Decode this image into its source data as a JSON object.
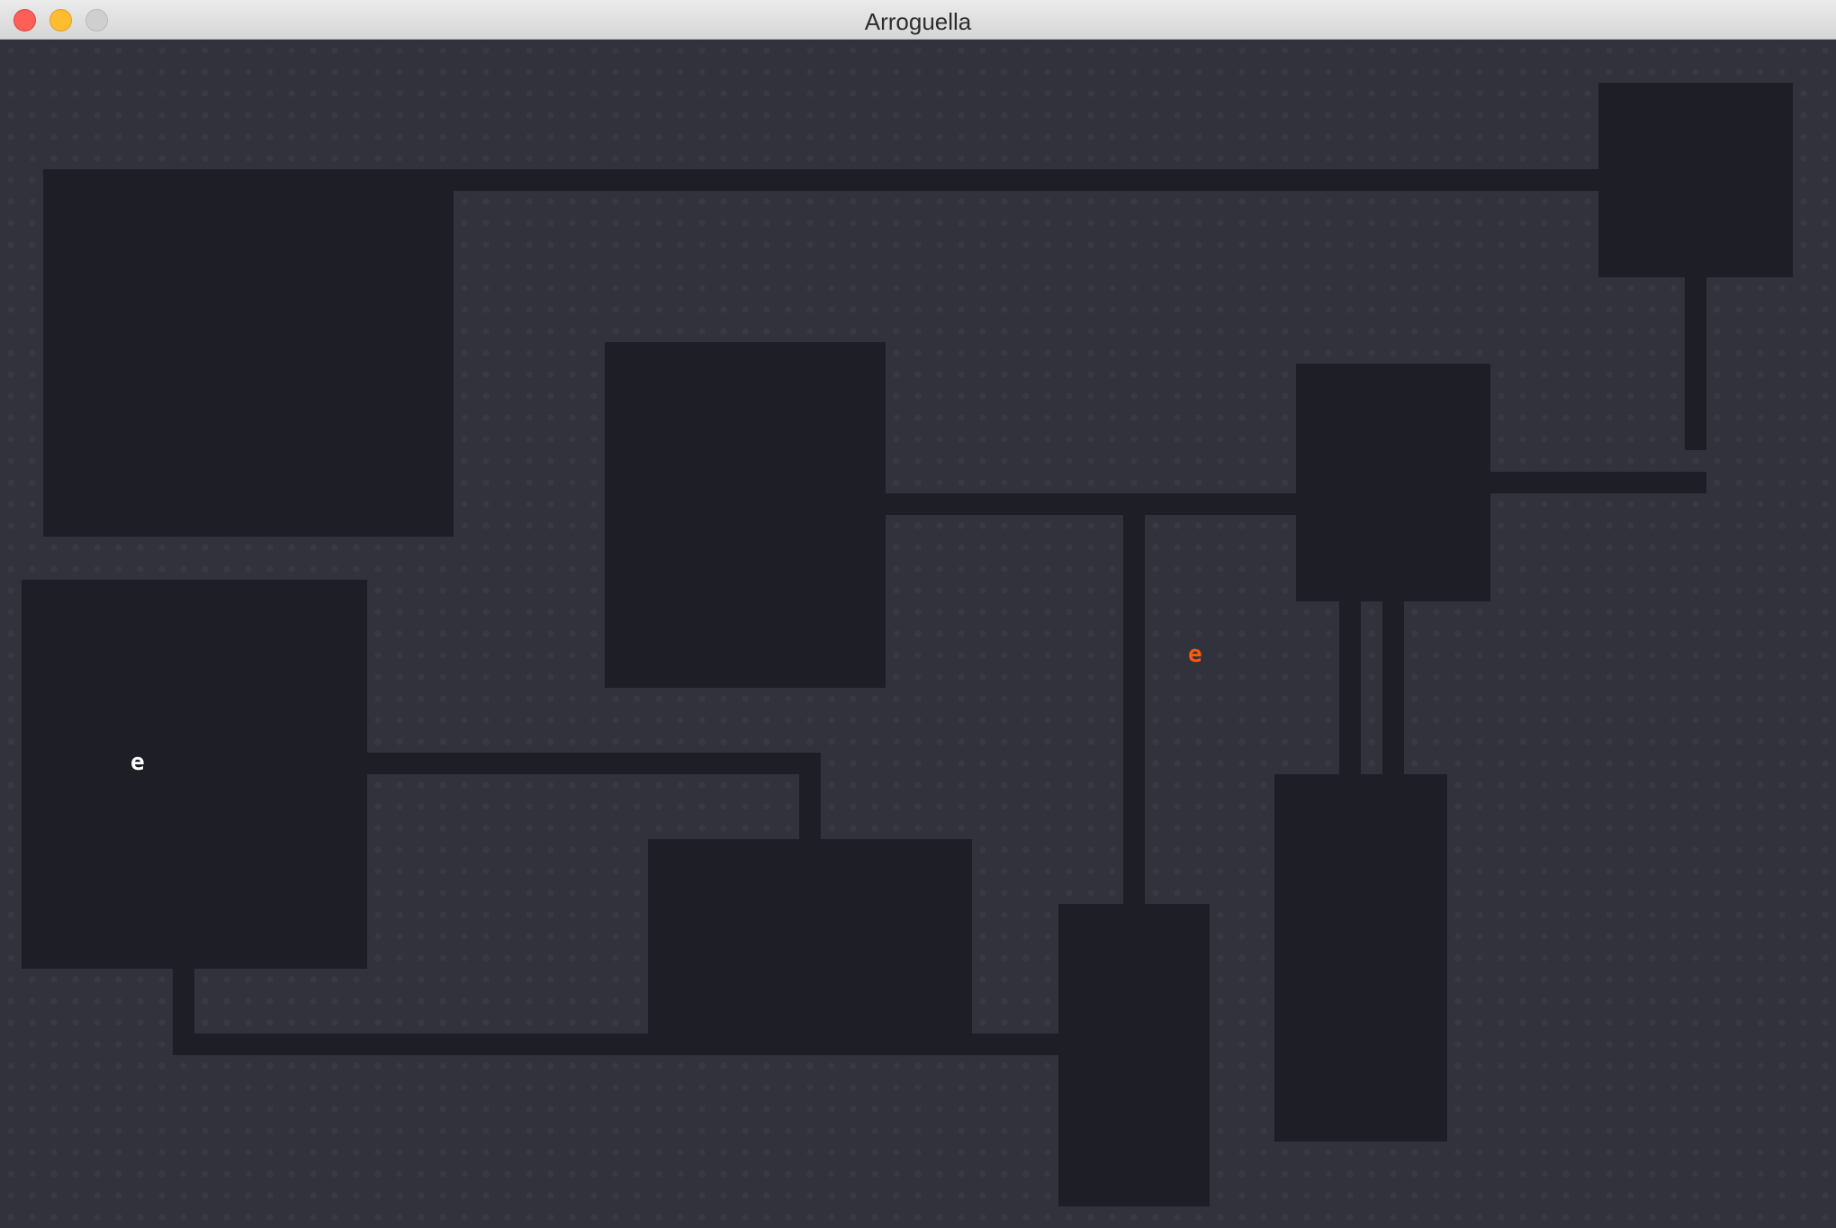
{
  "window": {
    "title": "Arroguella"
  },
  "colors": {
    "floor": "#1e1e27",
    "wall": "#32323c",
    "player": "#ffffff",
    "monster": "#ff5a0a"
  },
  "actors": {
    "player": {
      "glyph": "e",
      "icon": "player-glyph-icon"
    },
    "monster": {
      "glyph": "e",
      "icon": "monster-glyph-icon"
    }
  }
}
